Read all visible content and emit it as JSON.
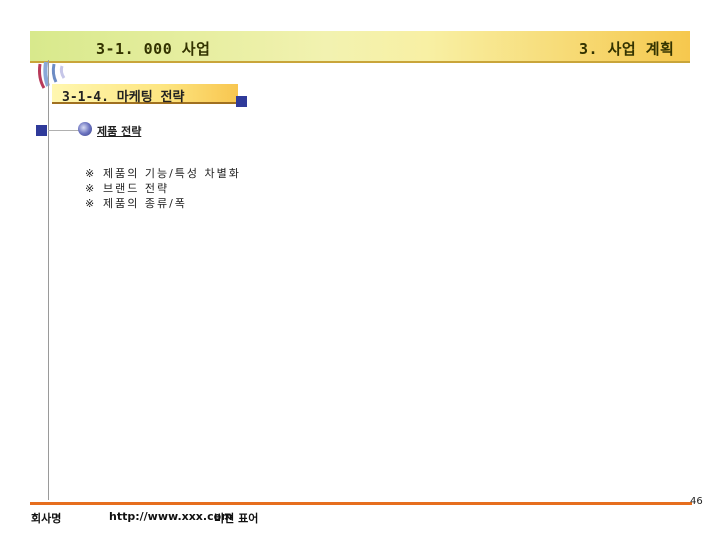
{
  "header": {
    "title": "3-1. 000 사업",
    "section": "3. 사업 계획"
  },
  "subtitle": "3-1-4. 마케팅 전략",
  "section_heading": "제품 전략",
  "bullets": [
    {
      "mark": "※",
      "text": "제품의 기능/특성 차별화"
    },
    {
      "mark": "※",
      "text": "브랜드 전략"
    },
    {
      "mark": "※",
      "text": "제품의 종류/폭"
    }
  ],
  "footer": {
    "company": "회사명",
    "url": "http://www.xxx.com",
    "vision": "비젼 표어",
    "page_number": "46"
  },
  "colors": {
    "accent_square": "#2f3a9a",
    "footer_line": "#e66e1e",
    "header_gradient_end": "#f6c84e"
  }
}
